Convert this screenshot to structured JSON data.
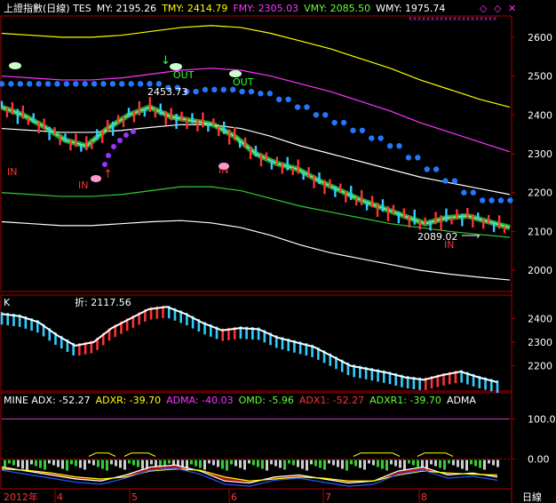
{
  "header": {
    "items": [
      {
        "text": "上證指數(日線) TES",
        "color": "#ffffff"
      },
      {
        "text": "MY: 2195.26",
        "color": "#ffffff"
      },
      {
        "text": "TMY: 2414.79",
        "color": "#ffff00"
      },
      {
        "text": "FMY: 2305.03",
        "color": "#ff33ff"
      },
      {
        "text": "VMY: 2085.50",
        "color": "#66ff33"
      },
      {
        "text": "WMY: 1975.74",
        "color": "#ffffff"
      }
    ]
  },
  "labels": {
    "out1": "OUT",
    "out2": "OUT",
    "in1": "IN",
    "in2": "IN",
    "in3": "IN",
    "in4": "IN",
    "high_value": "2453.73",
    "low_value": "2089.02",
    "panel2_k": "K",
    "panel2_val": "折: 2117.56"
  },
  "adx_header": [
    {
      "text": "MINE ADX: -52.27",
      "color": "#ffffff"
    },
    {
      "text": "ADXR: -39.70",
      "color": "#ffff00"
    },
    {
      "text": "ADMA: -40.03",
      "color": "#ff33ff"
    },
    {
      "text": "OMD: -5.96",
      "color": "#66ff33"
    },
    {
      "text": "ADX1: -52.27",
      "color": "#ff3333"
    },
    {
      "text": "ADXR1: -39.70",
      "color": "#66ff33"
    },
    {
      "text": "ADMA",
      "color": "#ffffff"
    }
  ],
  "bottom_bar": {
    "year": "2012年",
    "months": [
      "4",
      "5",
      "6",
      "7",
      "8"
    ],
    "period": "日線"
  },
  "chart_data": [
    {
      "type": "line",
      "title": "上證指數(日線)",
      "ylim": [
        1950,
        2650
      ],
      "yticks": [
        "2600",
        "2500",
        "2400",
        "2300",
        "2200",
        "2100",
        "2000"
      ],
      "ytick_values": [
        2600,
        2500,
        2400,
        2300,
        2200,
        2100,
        2000
      ],
      "series": [
        {
          "name": "TMY",
          "color": "#ffff00",
          "values": [
            2610,
            2605,
            2600,
            2600,
            2605,
            2615,
            2625,
            2630,
            2625,
            2610,
            2590,
            2570,
            2545,
            2520,
            2490,
            2465,
            2440,
            2420
          ]
        },
        {
          "name": "FMY",
          "color": "#ff33ff",
          "values": [
            2500,
            2495,
            2490,
            2490,
            2495,
            2505,
            2515,
            2520,
            2515,
            2500,
            2480,
            2460,
            2435,
            2410,
            2380,
            2355,
            2330,
            2305
          ]
        },
        {
          "name": "WMY",
          "color": "#ffffff",
          "values": [
            2365,
            2360,
            2355,
            2355,
            2360,
            2368,
            2375,
            2375,
            2365,
            2345,
            2320,
            2300,
            2280,
            2260,
            2240,
            2225,
            2210,
            2195
          ]
        },
        {
          "name": "VMY",
          "color": "#33cc33",
          "values": [
            2200,
            2195,
            2190,
            2190,
            2195,
            2205,
            2215,
            2215,
            2205,
            2185,
            2165,
            2150,
            2135,
            2120,
            2110,
            2100,
            2092,
            2085
          ]
        },
        {
          "name": "MY",
          "color": "#ffffff",
          "values": [
            2125,
            2120,
            2115,
            2115,
            2120,
            2125,
            2128,
            2122,
            2110,
            2090,
            2065,
            2045,
            2030,
            2015,
            2000,
            1990,
            1982,
            1975
          ]
        }
      ],
      "price": [
        2420,
        2400,
        2370,
        2335,
        2320,
        2365,
        2400,
        2420,
        2395,
        2385,
        2375,
        2345,
        2300,
        2275,
        2260,
        2230,
        2205,
        2180,
        2160,
        2140,
        2120,
        2135,
        2140,
        2125,
        2110
      ],
      "blue_dots": [
        2480,
        2480,
        2480,
        2480,
        2480,
        2480,
        2480,
        2480,
        2480,
        2470,
        2460,
        2465,
        2465,
        2460,
        2455,
        2440,
        2420,
        2400,
        2380,
        2360,
        2340,
        2320,
        2290,
        2260,
        2230,
        2200,
        2180,
        2180
      ]
    },
    {
      "type": "line",
      "ylim": [
        2100,
        2470
      ],
      "yticks": [
        "2400",
        "2300",
        "2200"
      ],
      "ytick_values": [
        2400,
        2300,
        2200
      ],
      "series": [
        {
          "name": "K",
          "color": "#ffffff",
          "values": [
            2420,
            2410,
            2385,
            2330,
            2285,
            2300,
            2360,
            2400,
            2440,
            2450,
            2420,
            2380,
            2350,
            2360,
            2355,
            2320,
            2300,
            2280,
            2240,
            2200,
            2185,
            2170,
            2150,
            2140,
            2160,
            2175,
            2150,
            2130
          ]
        }
      ]
    },
    {
      "type": "line",
      "ylim": [
        -70,
        130
      ],
      "yticks": [
        "100.0",
        "0.00"
      ],
      "ytick_values": [
        100,
        0
      ],
      "series": [
        {
          "name": "ADX",
          "color": "#ffffff",
          "values": [
            -20,
            -30,
            -40,
            -50,
            -55,
            -40,
            -20,
            -15,
            -30,
            -55,
            -60,
            -45,
            -40,
            -50,
            -60,
            -55,
            -30,
            -20,
            -40,
            -35,
            -45
          ]
        },
        {
          "name": "ADXR",
          "color": "#ffff00",
          "values": [
            -25,
            -28,
            -35,
            -45,
            -50,
            -45,
            -30,
            -25,
            -28,
            -45,
            -55,
            -50,
            -45,
            -48,
            -55,
            -55,
            -40,
            -30,
            -35,
            -38,
            -40
          ]
        }
      ]
    }
  ]
}
